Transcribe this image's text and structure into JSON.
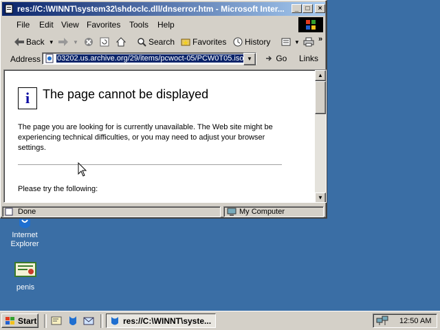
{
  "window": {
    "title": "res://C:\\WINNT\\system32\\shdoclc.dll/dnserror.htm - Microsoft Inter..."
  },
  "menu": [
    "File",
    "Edit",
    "View",
    "Favorites",
    "Tools",
    "Help"
  ],
  "toolbar": {
    "back": "Back",
    "search": "Search",
    "favorites": "Favorites",
    "history": "History"
  },
  "address": {
    "label": "Address",
    "value": "03202.us.archive.org/29/items/pcwoct-05/PCW0T05.iso",
    "go": "Go",
    "links": "Links"
  },
  "page": {
    "title": "The page cannot be displayed",
    "body": "The page you are looking for is currently unavailable. The Web site might be experiencing technical difficulties, or you may need to adjust your browser settings.",
    "try": "Please try the following:"
  },
  "status": {
    "text": "Done",
    "zone": "My Computer"
  },
  "desktop": {
    "icons": [
      {
        "label": "Internet Explorer"
      },
      {
        "label": "penis"
      }
    ]
  },
  "taskbar": {
    "start": "Start",
    "task": "res://C:\\WINNT\\syste...",
    "clock": "12:50 AM"
  },
  "colors": {
    "desktop": "#3a6ea5",
    "titlebar_active": "#0a246a",
    "face": "#d4d0c8"
  }
}
